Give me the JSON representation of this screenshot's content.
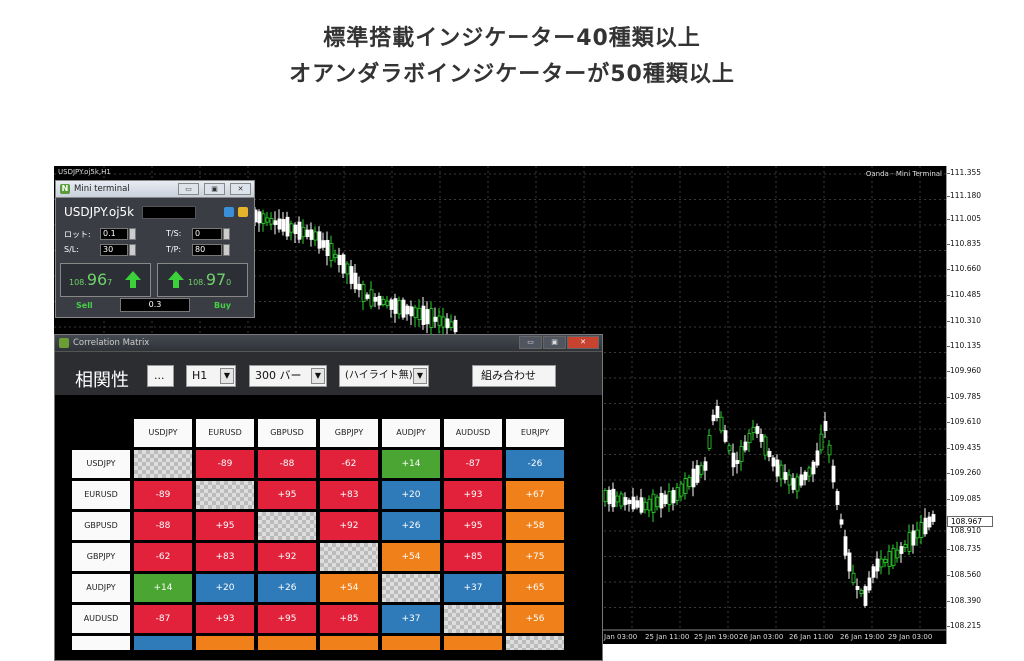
{
  "headline": {
    "line1": "標準搭載インジケーター40種類以上",
    "line2": "オアンダラボインジケーターが50種類以上"
  },
  "chart": {
    "title": "USDJPY.oj5k,H1",
    "tag": "Oanda - Mini Terminal",
    "current_price": "108.967",
    "current_price_alt": "108.910",
    "price_labels": [
      "111.355",
      "111.180",
      "111.005",
      "110.835",
      "110.660",
      "110.485",
      "110.310",
      "110.135",
      "109.960",
      "109.785",
      "109.610",
      "109.435",
      "109.260",
      "109.085",
      "108.735",
      "108.560",
      "108.390",
      "108.215"
    ],
    "time_labels": [
      "Jan 03:00",
      "25 Jan 11:00",
      "25 Jan 19:00",
      "26 Jan 03:00",
      "26 Jan 11:00",
      "26 Jan 19:00",
      "29 Jan 03:00"
    ],
    "colors": {
      "bull": "#2bd62b",
      "bear": "#ffffff",
      "grid": "#3a3a3a"
    }
  },
  "mini_terminal": {
    "title": "Mini terminal",
    "symbol": "USDJPY.oj5k",
    "lot_label": "ロット:",
    "lot_value": "0.1",
    "ts_label": "T/S:",
    "ts_value": "0",
    "sl_label": "S/L:",
    "sl_value": "30",
    "tp_label": "T/P:",
    "tp_value": "80",
    "sell_price_small": "108.",
    "sell_price_big": "96",
    "sell_price_frac": "7",
    "buy_price_small": "108.",
    "buy_price_big": "97",
    "buy_price_frac": "0",
    "sell_label": "Sell",
    "buy_label": "Buy",
    "spread": "0.3",
    "win_min": "▭",
    "win_max": "▣",
    "win_close": "✕"
  },
  "correlation": {
    "title": "Correlation Matrix",
    "heading": "相関性",
    "dots_button": "...",
    "timeframe": "H1",
    "bars": "300 バー",
    "highlight": "(ハイライト無)",
    "combine_button": "組み合わせ",
    "symbols": [
      "USDJPY",
      "EURUSD",
      "GBPUSD",
      "GBPJPY",
      "AUDJPY",
      "AUDUSD",
      "EURJPY"
    ],
    "rows": [
      [
        "",
        "-89",
        "-88",
        "-62",
        "+14",
        "-87",
        "-26"
      ],
      [
        "-89",
        "",
        "+95",
        "+83",
        "+20",
        "+93",
        "+67"
      ],
      [
        "-88",
        "+95",
        "",
        "+92",
        "+26",
        "+95",
        "+58"
      ],
      [
        "-62",
        "+83",
        "+92",
        "",
        "+54",
        "+85",
        "+75"
      ],
      [
        "+14",
        "+20",
        "+26",
        "+54",
        "",
        "+37",
        "+65"
      ],
      [
        "-87",
        "+93",
        "+95",
        "+85",
        "+37",
        "",
        "+56"
      ]
    ],
    "colors": {
      "red": "#e2223b",
      "orange": "#f0801a",
      "green": "#4aa532",
      "blue": "#2f7ab8"
    }
  }
}
